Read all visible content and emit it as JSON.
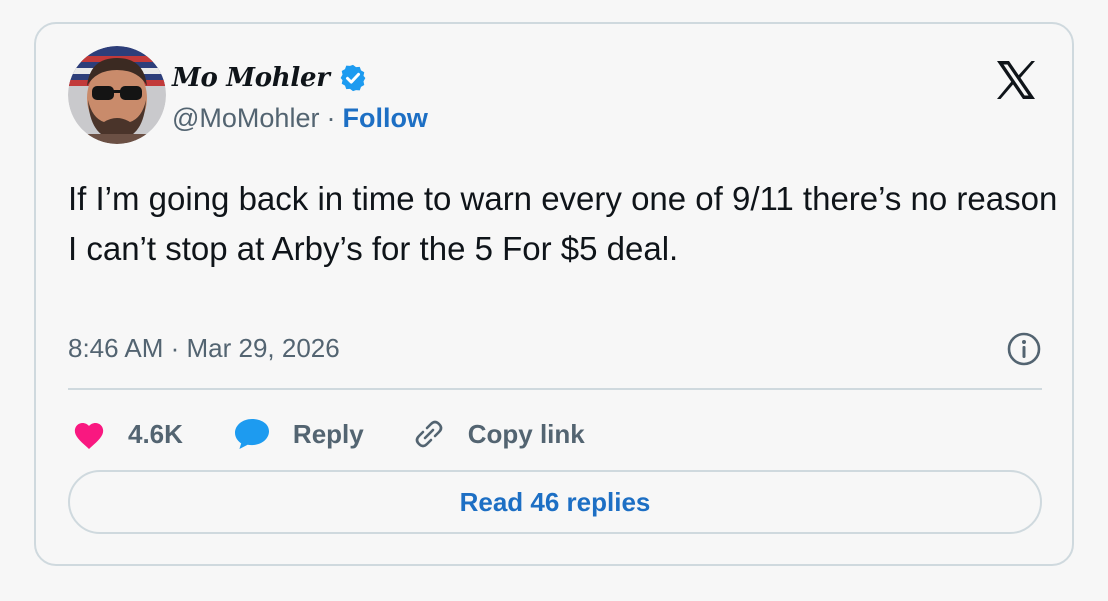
{
  "author": {
    "display_name": "Mo Mohler",
    "handle": "@MoMohler",
    "separator": "·",
    "follow_label": "Follow"
  },
  "tweet": {
    "text": "If I’m going back in time to warn every one of 9/11 there’s no reason I can’t stop at Arby’s for the 5 For $5 deal.",
    "timestamp": "8:46 AM · Mar 29, 2026"
  },
  "actions": {
    "like_count": "4.6K",
    "reply_label": "Reply",
    "copy_link_label": "Copy link"
  },
  "read_replies_label": "Read 46 replies",
  "icons": {
    "verified": "verified-badge-icon",
    "brand": "x-logo-icon",
    "info": "info-icon",
    "like": "heart-icon",
    "reply": "speech-bubble-icon",
    "copy": "link-icon"
  },
  "colors": {
    "accent": "#1d6fc4",
    "verified": "#1d9bf0",
    "like": "#f91880",
    "reply": "#1d9bf0",
    "text": "#0f1419",
    "muted": "#536471",
    "border": "#cfd9de"
  }
}
